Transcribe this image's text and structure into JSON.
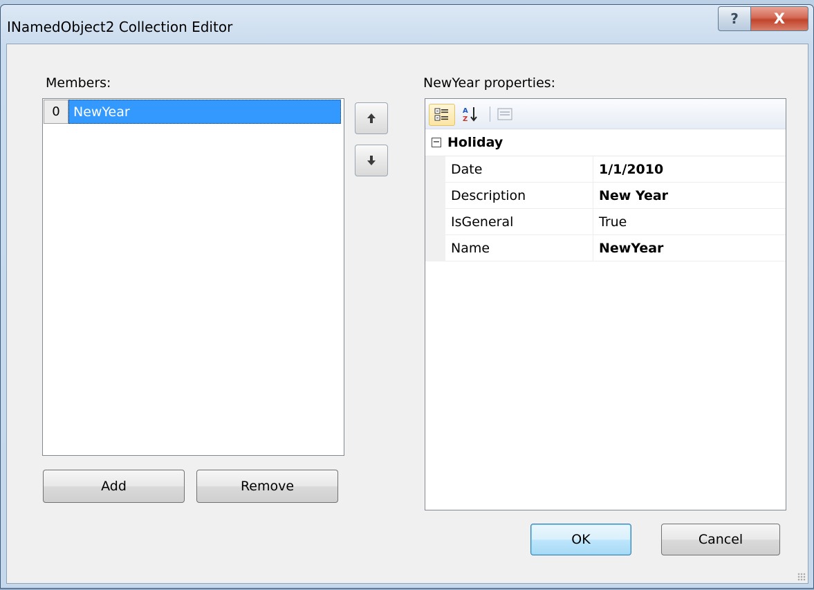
{
  "window": {
    "title": "INamedObject2 Collection Editor",
    "help_glyph": "?",
    "close_glyph": "X"
  },
  "members": {
    "label": "Members:",
    "items": [
      {
        "index": "0",
        "name": "NewYear",
        "selected": true
      }
    ],
    "move_up_icon": "arrow-up-icon",
    "move_down_icon": "arrow-down-icon",
    "add_label": "Add",
    "remove_label": "Remove"
  },
  "properties": {
    "label": "NewYear properties:",
    "toolbar": {
      "categorized_icon": "categorized-icon",
      "alphabetical_icon": "alphabetical-icon",
      "property_pages_icon": "property-pages-icon"
    },
    "category": {
      "toggle": "⊟",
      "name": "Holiday",
      "rows": [
        {
          "name": "Date",
          "value": "1/1/2010",
          "bold": true
        },
        {
          "name": "Description",
          "value": "New Year",
          "bold": true
        },
        {
          "name": "IsGeneral",
          "value": "True",
          "bold": false
        },
        {
          "name": "Name",
          "value": "NewYear",
          "bold": true
        }
      ]
    }
  },
  "footer": {
    "ok_label": "OK",
    "cancel_label": "Cancel"
  },
  "colors": {
    "selection": "#3399ff",
    "title_bar": "#c9dbee",
    "close_button": "#c2442c"
  }
}
